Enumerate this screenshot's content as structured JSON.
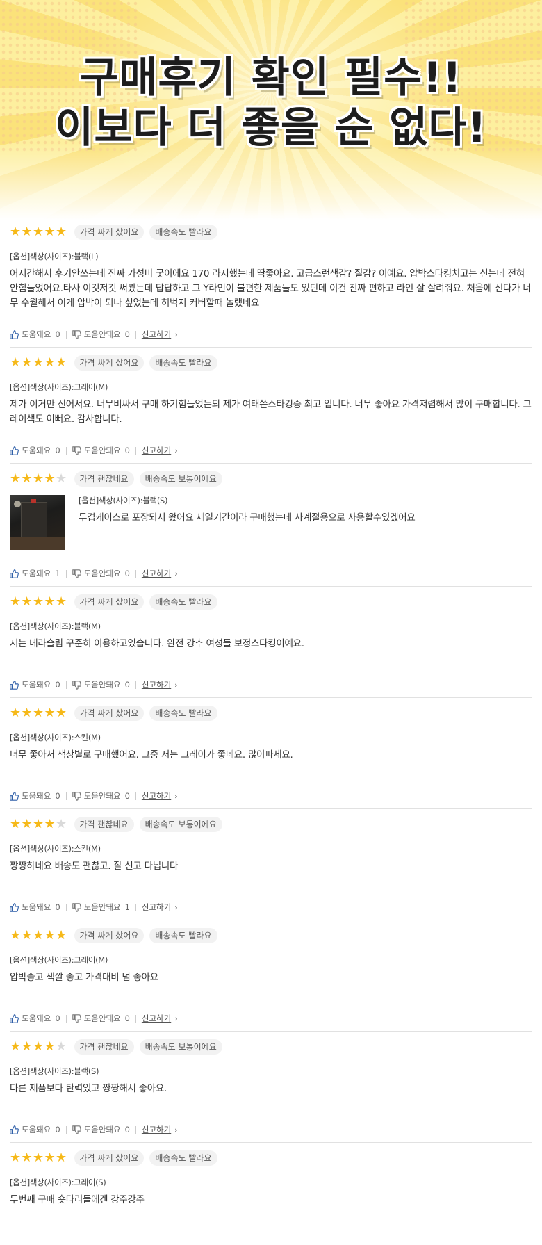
{
  "banner": {
    "line1": "구매후기 확인 필수!!",
    "line2": "이보다 더 좋을 순 없다!"
  },
  "colors": {
    "star_on": "#f6b919",
    "star_off": "#d9d9d9",
    "tag_bg": "#f2f2f2"
  },
  "labels": {
    "helpful": "도움돼요",
    "not_helpful": "도움안돼요",
    "report": "신고하기"
  },
  "reviews": [
    {
      "rating": 5,
      "tag_price": "가격 싸게 샀어요",
      "tag_ship": "배송속도 빨라요",
      "option": "[옵션]색상(사이즈):블랙(L)",
      "text": "어지간해서 후기안쓰는데 진짜 가성비 굿이에요 170 라지했는데 딱좋아요. 고급스런색감? 질감? 이예요. 압박스타킹치고는 신는데 전혀 안힘들었어요.타사 이것저것 써봤는데 답답하고 그 Y라인이 불편한 제품들도 있던데 이건 진짜 편하고 라인 잘 살려줘요. 처음에 신다가 너무 수월해서 이게 압박이 되나 싶었는데 허벅지 커버할때 놀랬네요",
      "helpful": "0",
      "not_helpful": "0"
    },
    {
      "rating": 5,
      "tag_price": "가격 싸게 샀어요",
      "tag_ship": "배송속도 빨라요",
      "option": "[옵션]색상(사이즈):그레이(M)",
      "text": "제가 이거만 신어서요. 너무비싸서 구매 하기힘들었는되 제가 여태쓴스타킹중 최고 입니다. 너무 좋아요 가격저렴해서 많이 구매합니다. 그레이색도 이뻐요. 감사합니다.",
      "helpful": "0",
      "not_helpful": "0"
    },
    {
      "rating": 4,
      "tag_price": "가격 괜찮네요",
      "tag_ship": "배송속도 보통이에요",
      "option": "[옵션]색상(사이즈):블랙(S)",
      "text": "두겹케이스로 포장되서 왔어요 세일기간이라 구매했는데 사계절용으로 사용할수있겠어요",
      "helpful": "1",
      "not_helpful": "0"
    },
    {
      "rating": 5,
      "tag_price": "가격 싸게 샀어요",
      "tag_ship": "배송속도 빨라요",
      "option": "[옵션]색상(사이즈):블랙(M)",
      "text": "저는 베라슬림 꾸준히 이용하고있습니다. 완전 강추 여성들 보정스타킹이예요.",
      "helpful": "0",
      "not_helpful": "0"
    },
    {
      "rating": 5,
      "tag_price": "가격 싸게 샀어요",
      "tag_ship": "배송속도 빨라요",
      "option": "[옵션]색상(사이즈):스킨(M)",
      "text": "너무 좋아서 색상별로 구매했어요. 그중 저는 그레이가 좋네요. 많이파세요.",
      "helpful": "0",
      "not_helpful": "0"
    },
    {
      "rating": 4,
      "tag_price": "가격 괜찮네요",
      "tag_ship": "배송속도 보통이에요",
      "option": "[옵션]색상(사이즈):스킨(M)",
      "text": "짱짱하네요 배송도 괜찮고. 잘 신고 다닙니다",
      "helpful": "0",
      "not_helpful": "1"
    },
    {
      "rating": 5,
      "tag_price": "가격 싸게 샀어요",
      "tag_ship": "배송속도 빨라요",
      "option": "[옵션]색상(사이즈):그레이(M)",
      "text": "압박좋고 색깔 좋고 가격대비 넘 좋아요",
      "helpful": "0",
      "not_helpful": "0"
    },
    {
      "rating": 4,
      "tag_price": "가격 괜찮네요",
      "tag_ship": "배송속도 보통이에요",
      "option": "[옵션]색상(사이즈):블랙(S)",
      "text": "다른 제품보다 탄력있고 짱짱해서 좋아요.",
      "helpful": "0",
      "not_helpful": "0"
    },
    {
      "rating": 5,
      "tag_price": "가격 싸게 샀어요",
      "tag_ship": "배송속도 빨라요",
      "option": "[옵션]색상(사이즈):그레이(S)",
      "text": "두번째 구매 숏다리들에겐 강주강주",
      "helpful": "",
      "not_helpful": ""
    }
  ]
}
